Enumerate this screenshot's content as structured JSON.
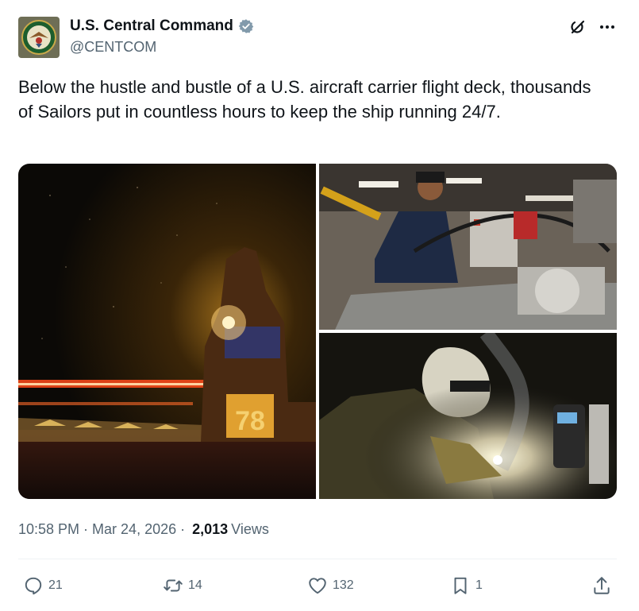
{
  "author": {
    "display_name": "U.S. Central Command",
    "handle": "@CENTCOM",
    "verified": true,
    "avatar_icon": "centcom-seal-icon"
  },
  "header_icons": [
    "grok-icon",
    "more-options-icon"
  ],
  "post": {
    "text": "Below the hustle and bustle of a U.S. aircraft carrier flight deck, thousands of Sailors put in countless hours to keep the ship running 24/7."
  },
  "media": [
    {
      "name": "aircraft-carrier-night-photo"
    },
    {
      "name": "sailor-lathe-machine-shop-photo"
    },
    {
      "name": "sailor-welding-photo"
    }
  ],
  "meta": {
    "time": "10:58 PM",
    "date": "Mar 24, 2026",
    "separator": "·",
    "views_count": "2,013",
    "views_label": "Views"
  },
  "actions": {
    "reply_count": "21",
    "repost_count": "14",
    "like_count": "132",
    "bookmark_count": "1"
  },
  "colors": {
    "text_primary": "#0f1419",
    "text_secondary": "#536471",
    "verified": "#829aab",
    "divider": "#eff3f4"
  }
}
